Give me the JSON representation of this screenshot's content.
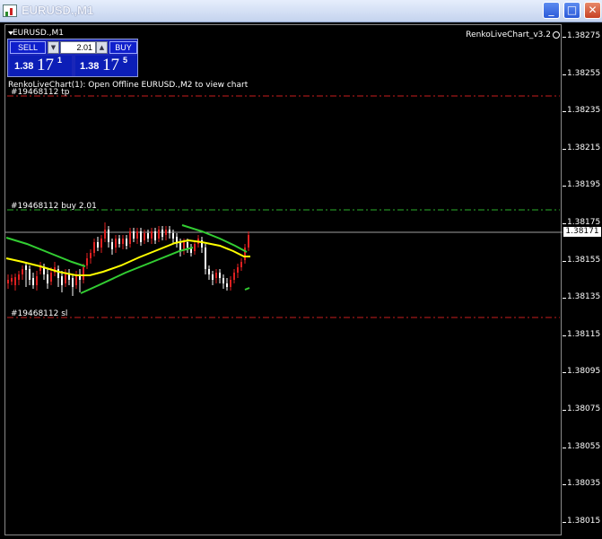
{
  "window": {
    "title": "EURUSD.,M1",
    "minimize_glyph": "_",
    "maximize_glyph": "□",
    "close_glyph": "✕"
  },
  "chart": {
    "symbol_label": "EURUSD.,M1",
    "indicator_name": "RenkoLiveChart_v3.2",
    "notice": "RenkoLiveChart(1): Open Offline EURUSD.,M2 to view chart"
  },
  "trade_panel": {
    "sell_label": "SELL",
    "buy_label": "BUY",
    "volume": "2.01",
    "sell_price": {
      "prefix": "1.38",
      "big": "17",
      "sup": "1"
    },
    "buy_price": {
      "prefix": "1.38",
      "big": "17",
      "sup": "5"
    }
  },
  "orders": {
    "tp_label": "#19468112 tp",
    "buy_label": "#19468112 buy 2.01",
    "sl_label": "#19468112 sl"
  },
  "price_axis": {
    "labels": [
      "1.38275",
      "1.38255",
      "1.38235",
      "1.38215",
      "1.38195",
      "1.38175",
      "1.38155",
      "1.38135",
      "1.38115",
      "1.38095",
      "1.38075",
      "1.38055",
      "1.38035",
      "1.38015"
    ],
    "current_price": "1.38171"
  },
  "colors": {
    "tp_line": "#c81e1e",
    "sl_line": "#c81e1e",
    "buy_line": "#2ab02a",
    "ma_yellow": "#ffff00",
    "ma_green": "#32cd32",
    "bull_candle": "#e02020",
    "bear_candle": "#ffffff",
    "current_line": "#a0a0a0"
  },
  "icons": {
    "app": "chart-app-icon",
    "smiley": "smiley-icon"
  }
}
